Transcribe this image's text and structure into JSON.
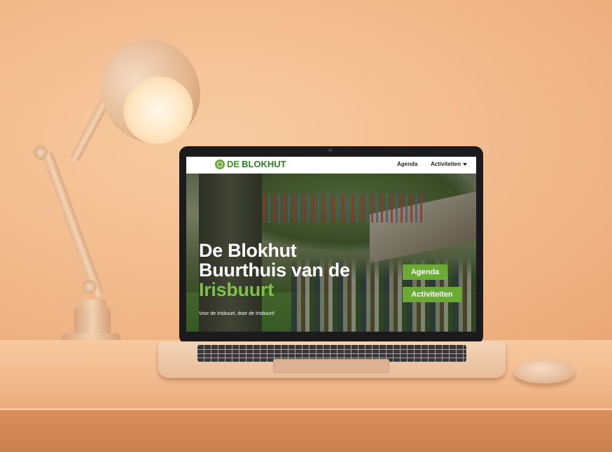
{
  "site": {
    "logo": {
      "prefix": "DE",
      "name": "BLOKHUT",
      "icon": "logo-circle-icon"
    },
    "nav": {
      "agenda_label": "Agenda",
      "activiteiten_label": "Activiteiten",
      "dropdown_icon": "caret-down-icon"
    },
    "hero": {
      "title_line1": "De Blokhut",
      "title_line2": "Buurthuis van de",
      "title_line3": "Irisbuurt",
      "subtitle": "Voor de Irisbuurt, door de Irisbuurt!",
      "buttons": {
        "agenda": "Agenda",
        "activiteiten": "Activiteiten"
      }
    },
    "colors": {
      "brand_green": "#6aaa35",
      "highlight_green": "#7cc244",
      "logo_green": "#3e8e2e"
    }
  }
}
